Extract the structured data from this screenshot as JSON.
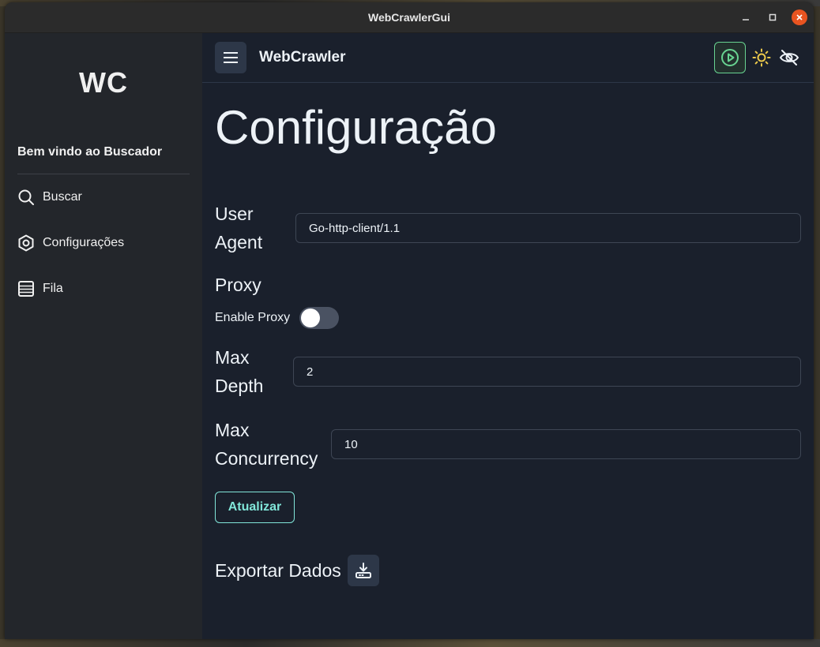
{
  "window": {
    "title": "WebCrawlerGui"
  },
  "sidebar": {
    "logo": "WC",
    "welcome": "Bem vindo ao Buscador",
    "items": [
      {
        "label": "Buscar",
        "icon": "search-icon"
      },
      {
        "label": "Configurações",
        "icon": "settings-icon"
      },
      {
        "label": "Fila",
        "icon": "list-icon"
      }
    ]
  },
  "header": {
    "brand": "WebCrawler",
    "icons": [
      "menu-icon",
      "play-icon",
      "sun-icon",
      "eye-off-icon"
    ]
  },
  "page": {
    "title": "Configuração",
    "user_agent": {
      "label_line1": "User",
      "label_line2": "Agent",
      "value": "Go-http-client/1.1"
    },
    "proxy": {
      "section": "Proxy",
      "toggle_label": "Enable Proxy",
      "enabled": false
    },
    "max_depth": {
      "label_line1": "Max",
      "label_line2": "Depth",
      "value": "2"
    },
    "max_concurrency": {
      "label_line1": "Max",
      "label_line2": "Concurrency",
      "value": "10"
    },
    "update_button": "Atualizar",
    "export_label": "Exportar Dados"
  },
  "colors": {
    "accent": "#81e6d9",
    "play_border": "#68d391",
    "sun": "#ecc94b",
    "background": "#1a202c",
    "sidebar": "#23262b"
  }
}
